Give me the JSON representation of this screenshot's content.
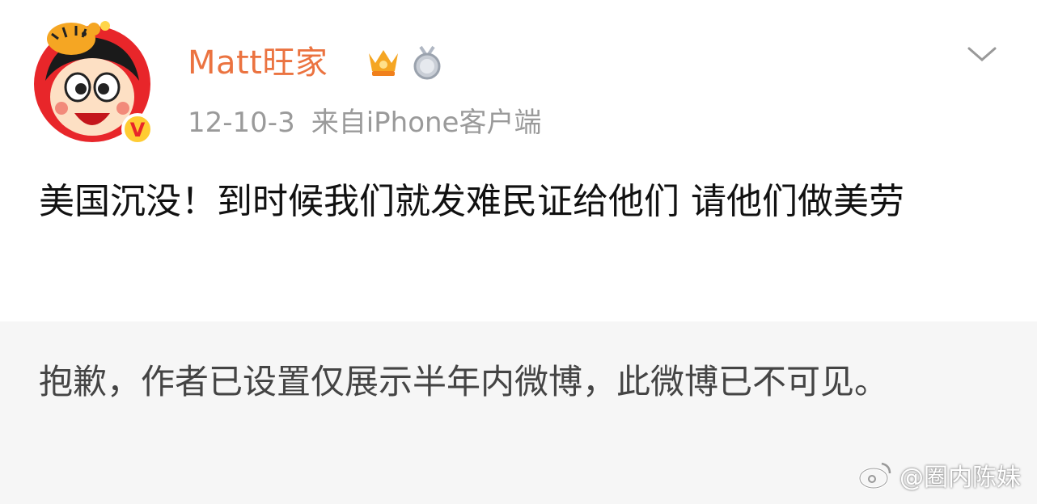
{
  "post": {
    "username": "Matt旺家",
    "date": "12-10-3",
    "source": "来自iPhone客户端",
    "content": "美国沉没！到时候我们就发难民证给他们 请他们做美劳",
    "verified_badge": "V",
    "icons": [
      "avatar-icon",
      "vip-crown-icon",
      "medal-icon",
      "chevron-down-icon"
    ],
    "accent_color": "#eb7340"
  },
  "notice": {
    "text": "抱歉，作者已设置仅展示半年内微博，此微博已不可见。"
  },
  "watermark": {
    "text": "@圈内陈妹"
  }
}
